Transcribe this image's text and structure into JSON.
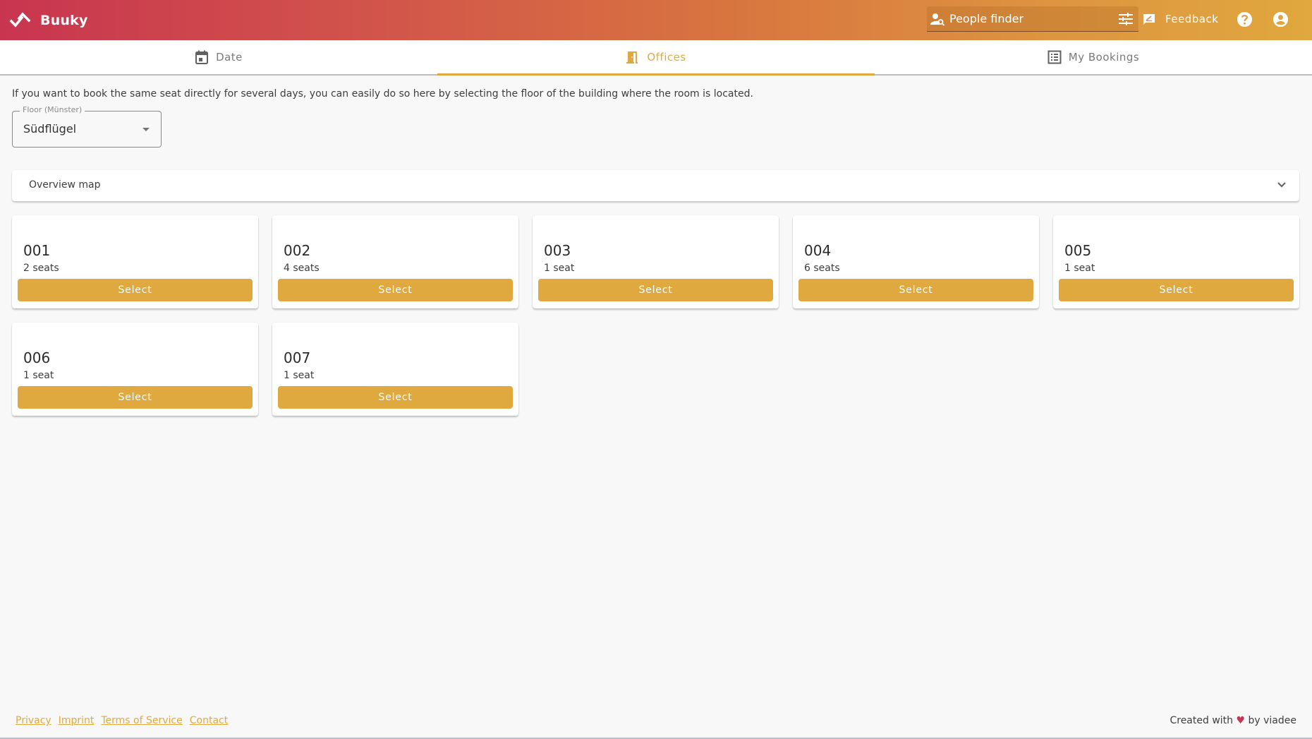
{
  "header": {
    "brand": "Buuky",
    "people_finder_placeholder": "People finder",
    "feedback_label": "Feedback",
    "icons": [
      "logo-icon",
      "person-search-icon",
      "tune-icon",
      "feedback-icon",
      "help-icon",
      "account-icon"
    ]
  },
  "tabs": [
    {
      "label": "Date",
      "icon": "calendar-icon",
      "active": false
    },
    {
      "label": "Offices",
      "icon": "door-icon",
      "active": true
    },
    {
      "label": "My Bookings",
      "icon": "list-icon",
      "active": false
    }
  ],
  "content": {
    "intro": "If you want to book the same seat directly for several days, you can easily do so here by selecting the floor of the building where the room is located.",
    "floor_select": {
      "label": "Floor (Münster)",
      "value": "Südflügel"
    },
    "overview_map": {
      "title": "Overview map",
      "expanded": false
    },
    "rooms": [
      {
        "name": "001",
        "seats": "2 seats",
        "button": "Select"
      },
      {
        "name": "002",
        "seats": "4 seats",
        "button": "Select"
      },
      {
        "name": "003",
        "seats": "1 seat",
        "button": "Select"
      },
      {
        "name": "004",
        "seats": "6 seats",
        "button": "Select"
      },
      {
        "name": "005",
        "seats": "1 seat",
        "button": "Select"
      },
      {
        "name": "006",
        "seats": "1 seat",
        "button": "Select"
      },
      {
        "name": "007",
        "seats": "1 seat",
        "button": "Select"
      }
    ]
  },
  "footer": {
    "links": [
      "Privacy",
      "Imprint",
      "Terms of Service",
      "Contact"
    ],
    "credit_prefix": "Created with",
    "credit_heart": "♥",
    "credit_suffix": "by viadee"
  },
  "colors": {
    "accent": "#e0a940",
    "header_start": "#c8354f",
    "header_end": "#e0a83e",
    "heart": "#c8354f"
  }
}
